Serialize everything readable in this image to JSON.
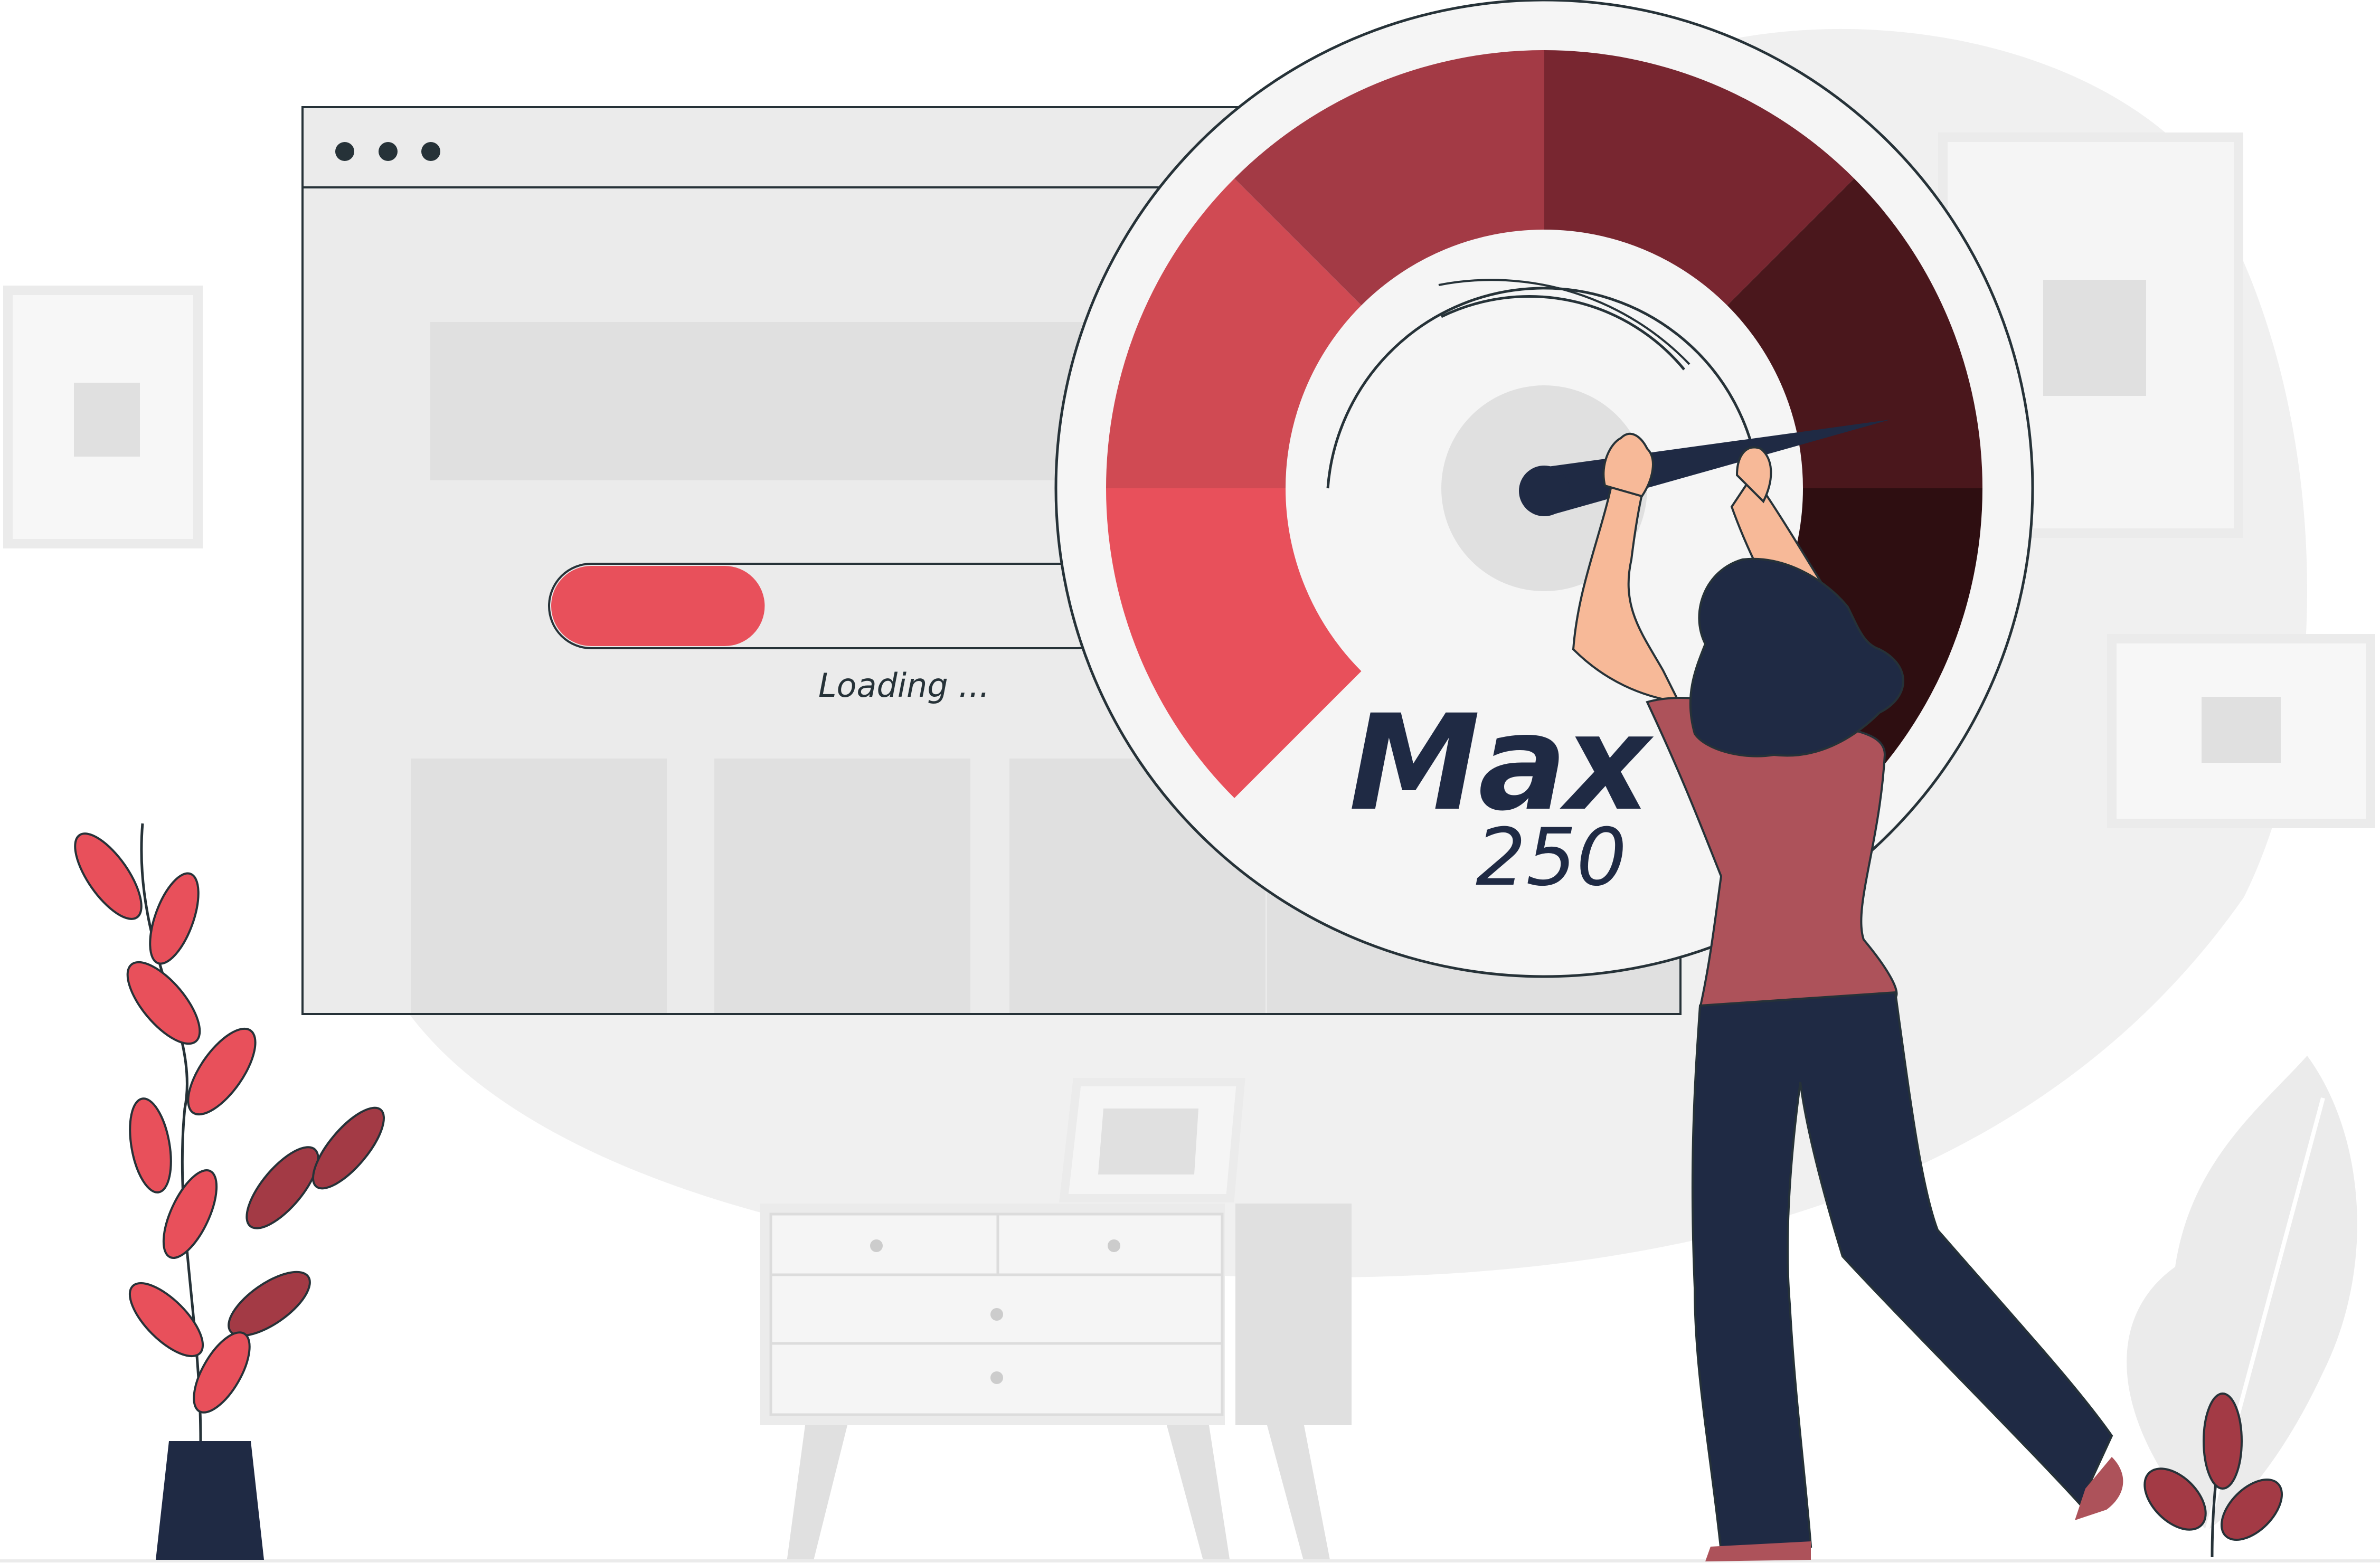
{
  "browser": {
    "window_dots": [
      "dot",
      "dot",
      "dot"
    ],
    "progress_fraction": 0.27,
    "loading_text": "Loading ..."
  },
  "gauge": {
    "label": "Max",
    "value_text": "250",
    "segment_colors": [
      "#e8505b",
      "#d04a53",
      "#a33a45",
      "#782630",
      "#4a171c",
      "#2e0e11"
    ]
  },
  "colors": {
    "accent": "#e8505b",
    "navy": "#1f2a44",
    "light_gray": "#ebebeb",
    "shirt": "#ad525a",
    "skin": "#f7b998"
  }
}
